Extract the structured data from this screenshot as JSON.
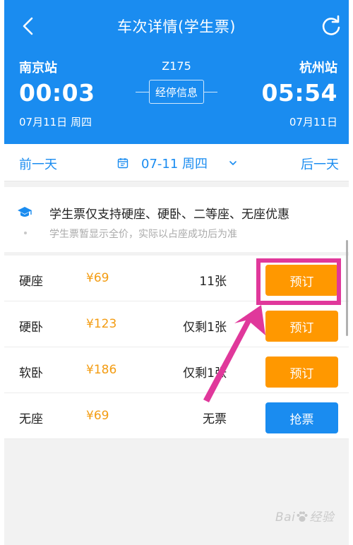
{
  "header": {
    "title": "车次详情(学生票)",
    "from_station": "南京站",
    "to_station": "杭州站",
    "train_no": "Z175",
    "depart_time": "00:03",
    "arrive_time": "05:54",
    "stops_label": "经停信息",
    "depart_date": "07月11日 周四",
    "arrive_date": "07月11日",
    "color": "#1a8cf0"
  },
  "date_bar": {
    "prev": "前一天",
    "date": "07-11 周四",
    "next": "后一天"
  },
  "notice": {
    "main": "学生票仅支持硬座、硬卧、二等座、无座优惠",
    "sub": "学生票暂显示全价，实际以占座成功后为准"
  },
  "seats": [
    {
      "name": "硬座",
      "price": "¥69",
      "remain": "11张",
      "action": "预订",
      "color": "#ff9800"
    },
    {
      "name": "硬卧",
      "price": "¥123",
      "remain": "仅剩1张",
      "action": "预订",
      "color": "#ff9800"
    },
    {
      "name": "软卧",
      "price": "¥186",
      "remain": "仅剩1张",
      "action": "预订",
      "color": "#ff9800"
    },
    {
      "name": "无座",
      "price": "¥69",
      "remain": "无票",
      "action": "抢票",
      "color": "#1a8cf0"
    }
  ],
  "watermark": {
    "pre": "Bai",
    "post": "经验"
  },
  "annotation_color": "#e0389b",
  "price_color": "#f39c12"
}
